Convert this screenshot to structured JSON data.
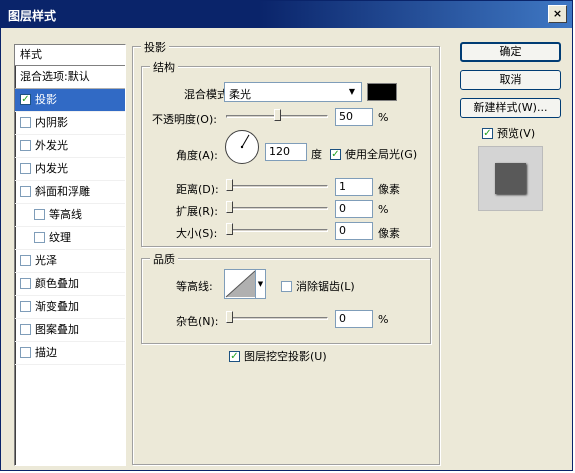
{
  "window": {
    "title": "图层样式",
    "close_glyph": "×"
  },
  "style_list": {
    "header": "样式",
    "first": "混合选项:默认",
    "items": [
      {
        "label": "投影",
        "checked": true,
        "selected": true
      },
      {
        "label": "内阴影",
        "checked": false
      },
      {
        "label": "外发光",
        "checked": false
      },
      {
        "label": "内发光",
        "checked": false
      },
      {
        "label": "斜面和浮雕",
        "checked": false
      },
      {
        "label": "等高线",
        "checked": false,
        "sub": true
      },
      {
        "label": "纹理",
        "checked": false,
        "sub": true
      },
      {
        "label": "光泽",
        "checked": false
      },
      {
        "label": "颜色叠加",
        "checked": false
      },
      {
        "label": "渐变叠加",
        "checked": false
      },
      {
        "label": "图案叠加",
        "checked": false
      },
      {
        "label": "描边",
        "checked": false
      }
    ]
  },
  "drop_shadow": {
    "section_title": "投影",
    "structure_title": "结构",
    "blend_mode_label": "混合模式:",
    "blend_mode_value": "柔光",
    "color": "#000000",
    "opacity_label": "不透明度(O):",
    "opacity_value": "50",
    "opacity_unit": "%",
    "opacity_percent": 50,
    "angle_label": "角度(A):",
    "angle_value": "120",
    "angle_unit": "度",
    "global_light_label": "使用全局光(G)",
    "global_light_checked": true,
    "distance_label": "距离(D):",
    "distance_value": "1",
    "distance_unit": "像素",
    "spread_label": "扩展(R):",
    "spread_value": "0",
    "spread_unit": "%",
    "size_label": "大小(S):",
    "size_value": "0",
    "size_unit": "像素",
    "quality_title": "品质",
    "contour_label": "等高线:",
    "antialias_label": "消除锯齿(L)",
    "antialias_checked": false,
    "noise_label": "杂色(N):",
    "noise_value": "0",
    "noise_unit": "%",
    "knockout_label": "图层挖空投影(U)",
    "knockout_checked": true
  },
  "buttons": {
    "ok": "确定",
    "cancel": "取消",
    "new_style": "新建样式(W)...",
    "preview_label": "预览(V)",
    "preview_checked": true
  }
}
